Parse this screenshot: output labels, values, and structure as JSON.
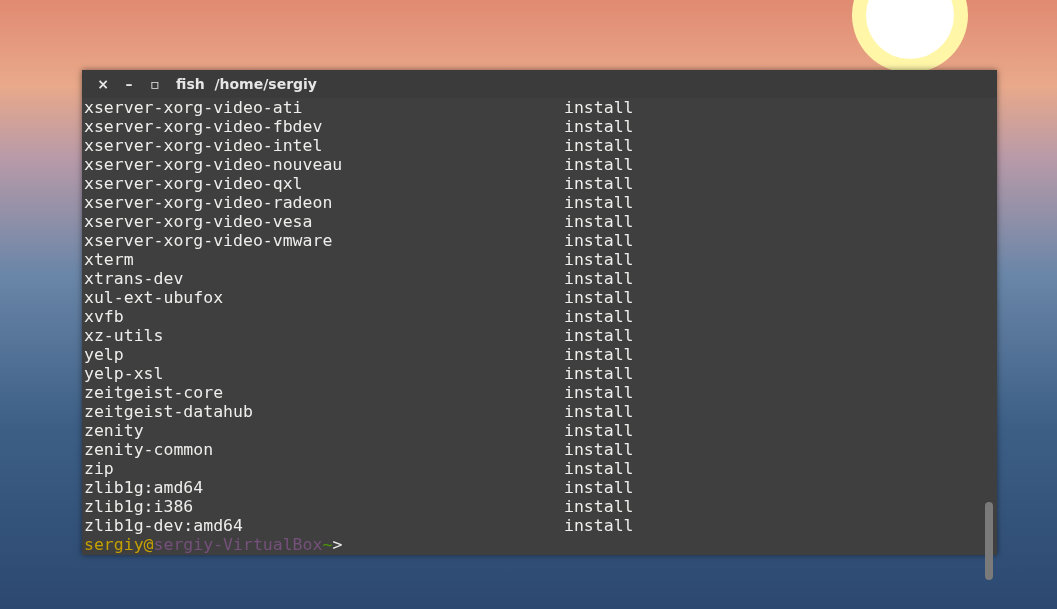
{
  "window": {
    "title": "fish  /home/sergiy",
    "buttons": [
      "×",
      "–",
      "▫"
    ]
  },
  "rows": [
    {
      "package": "xserver-xorg-video-ati",
      "status": "install"
    },
    {
      "package": "xserver-xorg-video-fbdev",
      "status": "install"
    },
    {
      "package": "xserver-xorg-video-intel",
      "status": "install"
    },
    {
      "package": "xserver-xorg-video-nouveau",
      "status": "install"
    },
    {
      "package": "xserver-xorg-video-qxl",
      "status": "install"
    },
    {
      "package": "xserver-xorg-video-radeon",
      "status": "install"
    },
    {
      "package": "xserver-xorg-video-vesa",
      "status": "install"
    },
    {
      "package": "xserver-xorg-video-vmware",
      "status": "install"
    },
    {
      "package": "xterm",
      "status": "install"
    },
    {
      "package": "xtrans-dev",
      "status": "install"
    },
    {
      "package": "xul-ext-ubufox",
      "status": "install"
    },
    {
      "package": "xvfb",
      "status": "install"
    },
    {
      "package": "xz-utils",
      "status": "install"
    },
    {
      "package": "yelp",
      "status": "install"
    },
    {
      "package": "yelp-xsl",
      "status": "install"
    },
    {
      "package": "zeitgeist-core",
      "status": "install"
    },
    {
      "package": "zeitgeist-datahub",
      "status": "install"
    },
    {
      "package": "zenity",
      "status": "install"
    },
    {
      "package": "zenity-common",
      "status": "install"
    },
    {
      "package": "zip",
      "status": "install"
    },
    {
      "package": "zlib1g:amd64",
      "status": "install"
    },
    {
      "package": "zlib1g:i386",
      "status": "install"
    },
    {
      "package": "zlib1g-dev:amd64",
      "status": "install"
    }
  ],
  "prompt": [
    {
      "text": "sergiy@",
      "color": "#c4a000"
    },
    {
      "text": "sergiy-VirtualBox",
      "color": "#75507b"
    },
    {
      "text": "~",
      "color": "#4e9a06"
    },
    {
      "text": ">",
      "color": "#eeeeec"
    }
  ]
}
